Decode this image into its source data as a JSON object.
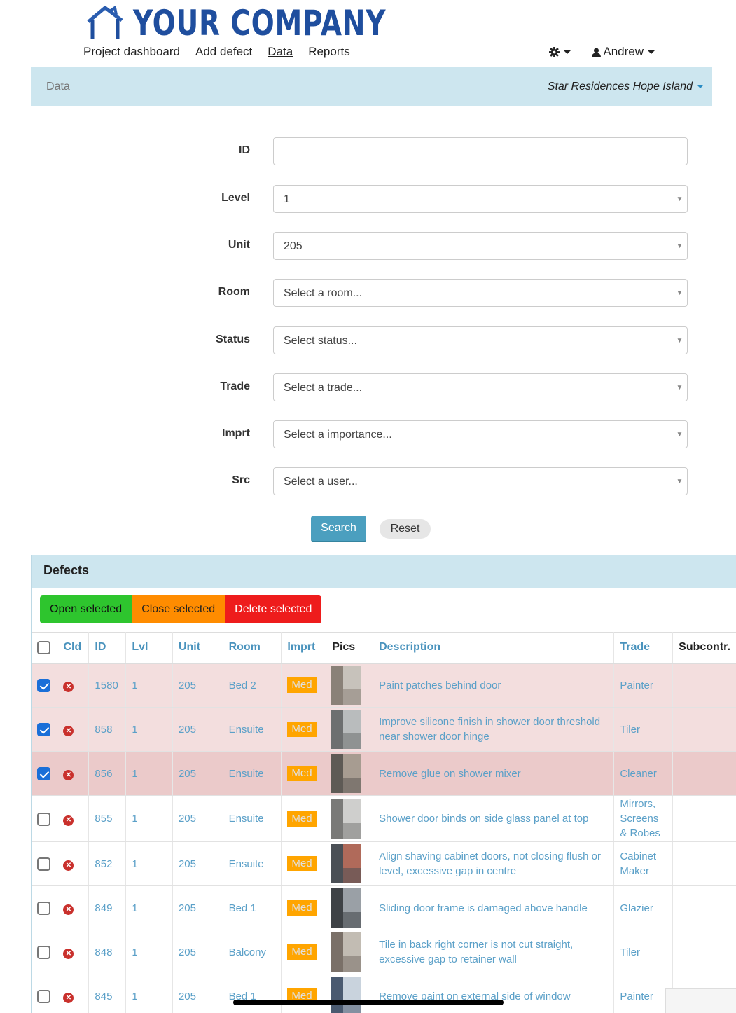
{
  "logo": {
    "text": "YOUR COMPANY"
  },
  "nav": {
    "items": [
      "Project dashboard",
      "Add defect",
      "Data",
      "Reports"
    ],
    "user": "Andrew"
  },
  "breadcrumb": {
    "left": "Data",
    "project": "Star Residences Hope Island"
  },
  "form": {
    "id_label": "ID",
    "id_value": "",
    "level_label": "Level",
    "level_value": "1",
    "unit_label": "Unit",
    "unit_value": "205",
    "room_label": "Room",
    "room_placeholder": "Select a room...",
    "status_label": "Status",
    "status_placeholder": "Select status...",
    "trade_label": "Trade",
    "trade_placeholder": "Select a trade...",
    "imprt_label": "Imprt",
    "imprt_placeholder": "Select a importance...",
    "src_label": "Src",
    "src_placeholder": "Select a user...",
    "search_label": "Search",
    "reset_label": "Reset"
  },
  "defects": {
    "title": "Defects",
    "actions": {
      "open": "Open selected",
      "close": "Close selected",
      "delete": "Delete selected"
    },
    "columns": [
      "Cld",
      "ID",
      "Lvl",
      "Unit",
      "Room",
      "Imprt",
      "Pics",
      "Description",
      "Trade",
      "Subcontr."
    ],
    "rows": [
      {
        "checked": true,
        "id": "1580",
        "lvl": "1",
        "unit": "205",
        "room": "Bed 2",
        "imprt": "Med",
        "desc": "Paint patches behind door",
        "trade": "Painter"
      },
      {
        "checked": true,
        "id": "858",
        "lvl": "1",
        "unit": "205",
        "room": "Ensuite",
        "imprt": "Med",
        "desc": "Improve silicone finish in shower door threshold near shower door hinge",
        "trade": "Tiler"
      },
      {
        "checked": true,
        "id": "856",
        "lvl": "1",
        "unit": "205",
        "room": "Ensuite",
        "imprt": "Med",
        "desc": "Remove glue on shower mixer",
        "trade": "Cleaner"
      },
      {
        "checked": false,
        "id": "855",
        "lvl": "1",
        "unit": "205",
        "room": "Ensuite",
        "imprt": "Med",
        "desc": "Shower door binds on side glass panel at top",
        "trade": "Mirrors, Screens & Robes"
      },
      {
        "checked": false,
        "id": "852",
        "lvl": "1",
        "unit": "205",
        "room": "Ensuite",
        "imprt": "Med",
        "desc": "Align shaving cabinet doors, not closing flush or level, excessive gap in centre",
        "trade": "Cabinet Maker"
      },
      {
        "checked": false,
        "id": "849",
        "lvl": "1",
        "unit": "205",
        "room": "Bed 1",
        "imprt": "Med",
        "desc": "Sliding door frame is damaged above handle",
        "trade": "Glazier"
      },
      {
        "checked": false,
        "id": "848",
        "lvl": "1",
        "unit": "205",
        "room": "Balcony",
        "imprt": "Med",
        "desc": "Tile in back right corner is not cut straight, excessive gap to retainer wall",
        "trade": "Tiler"
      },
      {
        "checked": false,
        "id": "845",
        "lvl": "1",
        "unit": "205",
        "room": "Bed 1",
        "imprt": "Med",
        "desc": "Remove paint on external side of window",
        "trade": "Painter"
      }
    ]
  },
  "colors": {
    "brand": "#1f4e9e",
    "panel": "#cde6ef",
    "link": "#5ba0c8",
    "open": "#2ec52e",
    "close": "#ff8c00",
    "delete": "#ee1c1c",
    "selected_row": "#f3dede"
  },
  "icons": {
    "logo": "house-icon",
    "settings": "gear-icon",
    "user": "user-icon",
    "closed": "close-circle-icon"
  }
}
